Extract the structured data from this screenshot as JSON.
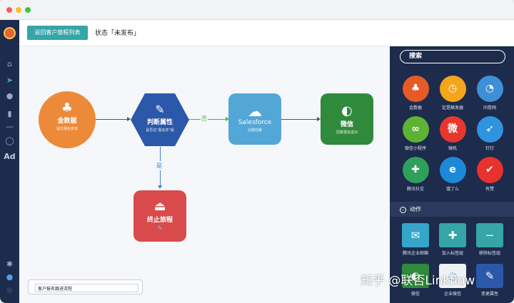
{
  "window": {
    "dots": [
      "#f25f58",
      "#fbbe2e",
      "#38c840"
    ]
  },
  "topbar": {
    "back_label": "返回客户旅程列表",
    "status": "状态「未发布」"
  },
  "rail": {
    "ad_label": "Ad"
  },
  "canvas": {
    "nodes": {
      "start": {
        "title": "金数据",
        "subtitle": "提交报名表单",
        "color": "#ec8a3a"
      },
      "judge": {
        "title": "判断属性",
        "subtitle": "是否在\"黑名单\"组",
        "color": "#2b58a8"
      },
      "salesforce": {
        "title": "Salesforce",
        "subtitle": "创建线索",
        "color": "#52a7d7"
      },
      "wechat": {
        "title": "微信",
        "subtitle": "回复报名成功",
        "color": "#2f8a3b"
      },
      "end": {
        "title": "终止旅程",
        "color": "#d94a4c"
      }
    },
    "edge_labels": {
      "no": "否",
      "yes": "是"
    },
    "footer_input_value": "客户报名跟进流程"
  },
  "right_panel": {
    "search_label": "搜索",
    "triggers": [
      {
        "label": "金数据",
        "icon": "sprout-icon",
        "color": "#e65a26"
      },
      {
        "label": "定是触发器",
        "icon": "clock-icon",
        "color": "#f3a51c"
      },
      {
        "label": "问卷网",
        "icon": "questionnaire-icon",
        "color": "#3f8fd6"
      },
      {
        "label": "微信小程序",
        "icon": "mini-program-icon",
        "color": "#5db434"
      },
      {
        "label": "微吼",
        "icon": "weihou-icon",
        "color": "#e8362f"
      },
      {
        "label": "钉钉",
        "icon": "dingtalk-icon",
        "color": "#2f93e0"
      },
      {
        "label": "腾讯社交",
        "icon": "tencent-social-icon",
        "color": "#2fa05a"
      },
      {
        "label": "饿了么",
        "icon": "eleme-icon",
        "color": "#1e88d8"
      },
      {
        "label": "有赞",
        "icon": "youzan-icon",
        "color": "#e8322d"
      }
    ],
    "action_header": "动作",
    "actions": [
      {
        "label": "腾讯企业邮箱",
        "icon": "mail-icon",
        "color": "#35a5c9"
      },
      {
        "label": "加入标签组",
        "icon": "add-user-icon",
        "color": "#35a5a8"
      },
      {
        "label": "移除标签组",
        "icon": "remove-user-icon",
        "color": "#35a5a8"
      },
      {
        "label": "微信",
        "icon": "wechat-icon",
        "color": "#2f8a3b"
      },
      {
        "label": "企业微信",
        "icon": "work-wechat-icon",
        "color": "#eef2f5"
      },
      {
        "label": "变更属性",
        "icon": "edit-icon",
        "color": "#2b58a8"
      }
    ]
  },
  "watermark": "知乎 @联否Linkflow"
}
